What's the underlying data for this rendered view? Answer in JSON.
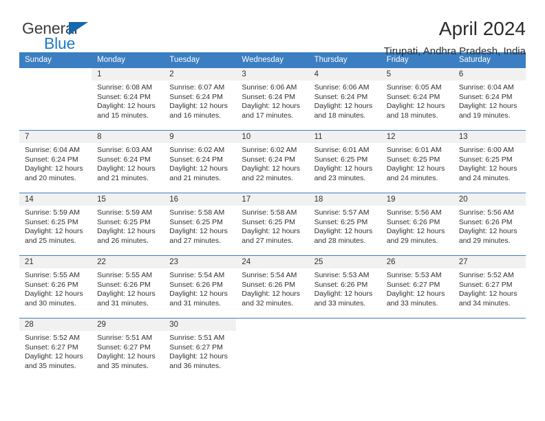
{
  "brand": {
    "word_one": "General",
    "word_two": "Blue",
    "flag_icon": "blue-triangle-flag-icon"
  },
  "header": {
    "title": "April 2024",
    "subtitle": "Tirupati, Andhra Pradesh, India"
  },
  "colors": {
    "header_blue": "#3b7ec1",
    "brand_blue": "#1f7ac4",
    "daynum_band": "#f1f1f1",
    "text": "#303030"
  },
  "weekday_headers": [
    "Sunday",
    "Monday",
    "Tuesday",
    "Wednesday",
    "Thursday",
    "Friday",
    "Saturday"
  ],
  "labels": {
    "sunrise_prefix": "Sunrise:",
    "sunset_prefix": "Sunset:",
    "daylight_prefix": "Daylight:"
  },
  "weeks": [
    [
      {
        "day": "",
        "blank": true
      },
      {
        "day": "1",
        "sunrise": "Sunrise: 6:08 AM",
        "sunset": "Sunset: 6:24 PM",
        "daylight_1": "Daylight: 12 hours",
        "daylight_2": "and 15 minutes."
      },
      {
        "day": "2",
        "sunrise": "Sunrise: 6:07 AM",
        "sunset": "Sunset: 6:24 PM",
        "daylight_1": "Daylight: 12 hours",
        "daylight_2": "and 16 minutes."
      },
      {
        "day": "3",
        "sunrise": "Sunrise: 6:06 AM",
        "sunset": "Sunset: 6:24 PM",
        "daylight_1": "Daylight: 12 hours",
        "daylight_2": "and 17 minutes."
      },
      {
        "day": "4",
        "sunrise": "Sunrise: 6:06 AM",
        "sunset": "Sunset: 6:24 PM",
        "daylight_1": "Daylight: 12 hours",
        "daylight_2": "and 18 minutes."
      },
      {
        "day": "5",
        "sunrise": "Sunrise: 6:05 AM",
        "sunset": "Sunset: 6:24 PM",
        "daylight_1": "Daylight: 12 hours",
        "daylight_2": "and 18 minutes."
      },
      {
        "day": "6",
        "sunrise": "Sunrise: 6:04 AM",
        "sunset": "Sunset: 6:24 PM",
        "daylight_1": "Daylight: 12 hours",
        "daylight_2": "and 19 minutes."
      }
    ],
    [
      {
        "day": "7",
        "sunrise": "Sunrise: 6:04 AM",
        "sunset": "Sunset: 6:24 PM",
        "daylight_1": "Daylight: 12 hours",
        "daylight_2": "and 20 minutes."
      },
      {
        "day": "8",
        "sunrise": "Sunrise: 6:03 AM",
        "sunset": "Sunset: 6:24 PM",
        "daylight_1": "Daylight: 12 hours",
        "daylight_2": "and 21 minutes."
      },
      {
        "day": "9",
        "sunrise": "Sunrise: 6:02 AM",
        "sunset": "Sunset: 6:24 PM",
        "daylight_1": "Daylight: 12 hours",
        "daylight_2": "and 21 minutes."
      },
      {
        "day": "10",
        "sunrise": "Sunrise: 6:02 AM",
        "sunset": "Sunset: 6:24 PM",
        "daylight_1": "Daylight: 12 hours",
        "daylight_2": "and 22 minutes."
      },
      {
        "day": "11",
        "sunrise": "Sunrise: 6:01 AM",
        "sunset": "Sunset: 6:25 PM",
        "daylight_1": "Daylight: 12 hours",
        "daylight_2": "and 23 minutes."
      },
      {
        "day": "12",
        "sunrise": "Sunrise: 6:01 AM",
        "sunset": "Sunset: 6:25 PM",
        "daylight_1": "Daylight: 12 hours",
        "daylight_2": "and 24 minutes."
      },
      {
        "day": "13",
        "sunrise": "Sunrise: 6:00 AM",
        "sunset": "Sunset: 6:25 PM",
        "daylight_1": "Daylight: 12 hours",
        "daylight_2": "and 24 minutes."
      }
    ],
    [
      {
        "day": "14",
        "sunrise": "Sunrise: 5:59 AM",
        "sunset": "Sunset: 6:25 PM",
        "daylight_1": "Daylight: 12 hours",
        "daylight_2": "and 25 minutes."
      },
      {
        "day": "15",
        "sunrise": "Sunrise: 5:59 AM",
        "sunset": "Sunset: 6:25 PM",
        "daylight_1": "Daylight: 12 hours",
        "daylight_2": "and 26 minutes."
      },
      {
        "day": "16",
        "sunrise": "Sunrise: 5:58 AM",
        "sunset": "Sunset: 6:25 PM",
        "daylight_1": "Daylight: 12 hours",
        "daylight_2": "and 27 minutes."
      },
      {
        "day": "17",
        "sunrise": "Sunrise: 5:58 AM",
        "sunset": "Sunset: 6:25 PM",
        "daylight_1": "Daylight: 12 hours",
        "daylight_2": "and 27 minutes."
      },
      {
        "day": "18",
        "sunrise": "Sunrise: 5:57 AM",
        "sunset": "Sunset: 6:25 PM",
        "daylight_1": "Daylight: 12 hours",
        "daylight_2": "and 28 minutes."
      },
      {
        "day": "19",
        "sunrise": "Sunrise: 5:56 AM",
        "sunset": "Sunset: 6:26 PM",
        "daylight_1": "Daylight: 12 hours",
        "daylight_2": "and 29 minutes."
      },
      {
        "day": "20",
        "sunrise": "Sunrise: 5:56 AM",
        "sunset": "Sunset: 6:26 PM",
        "daylight_1": "Daylight: 12 hours",
        "daylight_2": "and 29 minutes."
      }
    ],
    [
      {
        "day": "21",
        "sunrise": "Sunrise: 5:55 AM",
        "sunset": "Sunset: 6:26 PM",
        "daylight_1": "Daylight: 12 hours",
        "daylight_2": "and 30 minutes."
      },
      {
        "day": "22",
        "sunrise": "Sunrise: 5:55 AM",
        "sunset": "Sunset: 6:26 PM",
        "daylight_1": "Daylight: 12 hours",
        "daylight_2": "and 31 minutes."
      },
      {
        "day": "23",
        "sunrise": "Sunrise: 5:54 AM",
        "sunset": "Sunset: 6:26 PM",
        "daylight_1": "Daylight: 12 hours",
        "daylight_2": "and 31 minutes."
      },
      {
        "day": "24",
        "sunrise": "Sunrise: 5:54 AM",
        "sunset": "Sunset: 6:26 PM",
        "daylight_1": "Daylight: 12 hours",
        "daylight_2": "and 32 minutes."
      },
      {
        "day": "25",
        "sunrise": "Sunrise: 5:53 AM",
        "sunset": "Sunset: 6:26 PM",
        "daylight_1": "Daylight: 12 hours",
        "daylight_2": "and 33 minutes."
      },
      {
        "day": "26",
        "sunrise": "Sunrise: 5:53 AM",
        "sunset": "Sunset: 6:27 PM",
        "daylight_1": "Daylight: 12 hours",
        "daylight_2": "and 33 minutes."
      },
      {
        "day": "27",
        "sunrise": "Sunrise: 5:52 AM",
        "sunset": "Sunset: 6:27 PM",
        "daylight_1": "Daylight: 12 hours",
        "daylight_2": "and 34 minutes."
      }
    ],
    [
      {
        "day": "28",
        "sunrise": "Sunrise: 5:52 AM",
        "sunset": "Sunset: 6:27 PM",
        "daylight_1": "Daylight: 12 hours",
        "daylight_2": "and 35 minutes."
      },
      {
        "day": "29",
        "sunrise": "Sunrise: 5:51 AM",
        "sunset": "Sunset: 6:27 PM",
        "daylight_1": "Daylight: 12 hours",
        "daylight_2": "and 35 minutes."
      },
      {
        "day": "30",
        "sunrise": "Sunrise: 5:51 AM",
        "sunset": "Sunset: 6:27 PM",
        "daylight_1": "Daylight: 12 hours",
        "daylight_2": "and 36 minutes."
      },
      {
        "day": "",
        "blank": true
      },
      {
        "day": "",
        "blank": true
      },
      {
        "day": "",
        "blank": true
      },
      {
        "day": "",
        "blank": true
      }
    ]
  ]
}
